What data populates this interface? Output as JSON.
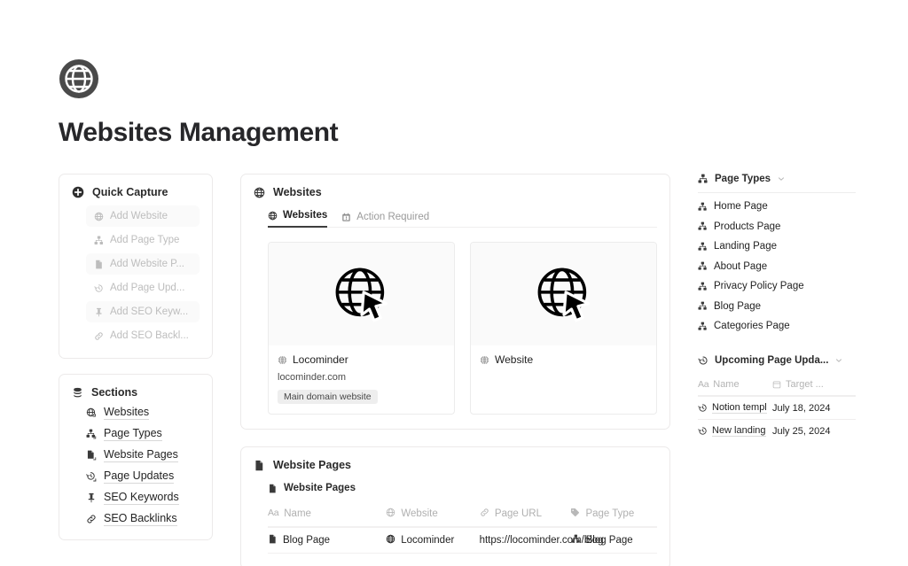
{
  "header": {
    "title": "Websites Management",
    "icon": "globe-icon"
  },
  "quick_capture": {
    "title": "Quick Capture",
    "icon": "plus-circle-icon",
    "items": [
      {
        "label": "Add Website",
        "icon": "globe-icon"
      },
      {
        "label": "Add Page Type",
        "icon": "sitemap-icon"
      },
      {
        "label": "Add Website P...",
        "icon": "document-icon"
      },
      {
        "label": "Add Page Upd...",
        "icon": "clock-history-icon"
      },
      {
        "label": "Add SEO Keyw...",
        "icon": "pin-icon"
      },
      {
        "label": "Add SEO Backl...",
        "icon": "link-icon"
      }
    ]
  },
  "sections": {
    "title": "Sections",
    "icon": "database-icon",
    "items": [
      {
        "label": "Websites",
        "icon": "globe-link-icon"
      },
      {
        "label": "Page Types",
        "icon": "sitemap-link-icon"
      },
      {
        "label": "Website Pages",
        "icon": "document-link-icon"
      },
      {
        "label": "Page Updates",
        "icon": "clock-history-link-icon"
      },
      {
        "label": "SEO Keywords",
        "icon": "pin-icon"
      },
      {
        "label": "SEO Backlinks",
        "icon": "link-icon"
      }
    ]
  },
  "websites_panel": {
    "title": "Websites",
    "icon": "globe-icon",
    "tabs": [
      {
        "label": "Websites",
        "icon": "globe-icon",
        "active": true
      },
      {
        "label": "Action Required",
        "icon": "calendar-alert-icon",
        "active": false
      }
    ],
    "cards": [
      {
        "title": "Locominder",
        "url": "locominder.com",
        "tag": "Main domain website",
        "icon": "globe-cursor-icon"
      },
      {
        "title": "Website",
        "url": "",
        "tag": "",
        "icon": "globe-cursor-icon"
      }
    ]
  },
  "website_pages_panel": {
    "title": "Website Pages",
    "icon": "document-icon",
    "subtitle": "Website Pages",
    "columns": [
      {
        "label": "Name",
        "icon": "aa-icon"
      },
      {
        "label": "Website",
        "icon": "globe-icon"
      },
      {
        "label": "Page URL",
        "icon": "link-icon"
      },
      {
        "label": "Page Type",
        "icon": "tag-icon"
      }
    ],
    "rows": [
      {
        "name": "Blog Page",
        "website": "Locominder",
        "page_url": "https://locominder.com/blog",
        "page_type": "Blog Page"
      }
    ]
  },
  "page_types_panel": {
    "title": "Page Types",
    "icon": "sitemap-icon",
    "chevron": "chevron-down-icon",
    "items": [
      {
        "label": "Home Page"
      },
      {
        "label": "Products Page"
      },
      {
        "label": "Landing Page"
      },
      {
        "label": "About Page"
      },
      {
        "label": "Privacy Policy Page"
      },
      {
        "label": "Blog Page"
      },
      {
        "label": "Categories Page"
      }
    ]
  },
  "upcoming_updates_panel": {
    "title": "Upcoming Page Upda...",
    "icon": "clock-history-icon",
    "chevron": "chevron-down-icon",
    "columns": [
      {
        "label": "Name",
        "icon": "aa-icon"
      },
      {
        "label": "Target ...",
        "icon": "calendar-icon"
      }
    ],
    "rows": [
      {
        "name": "Notion templ",
        "target_date": "July 18, 2024"
      },
      {
        "name": "New landing",
        "target_date": "July 25, 2024"
      }
    ]
  },
  "colors": {
    "text": "#1f1f1f",
    "muted": "#9a9a9a",
    "disabled": "#bdbdbd",
    "border": "#eceaea",
    "card_bg": "#fafafa",
    "tag_bg": "#eeeeee"
  }
}
